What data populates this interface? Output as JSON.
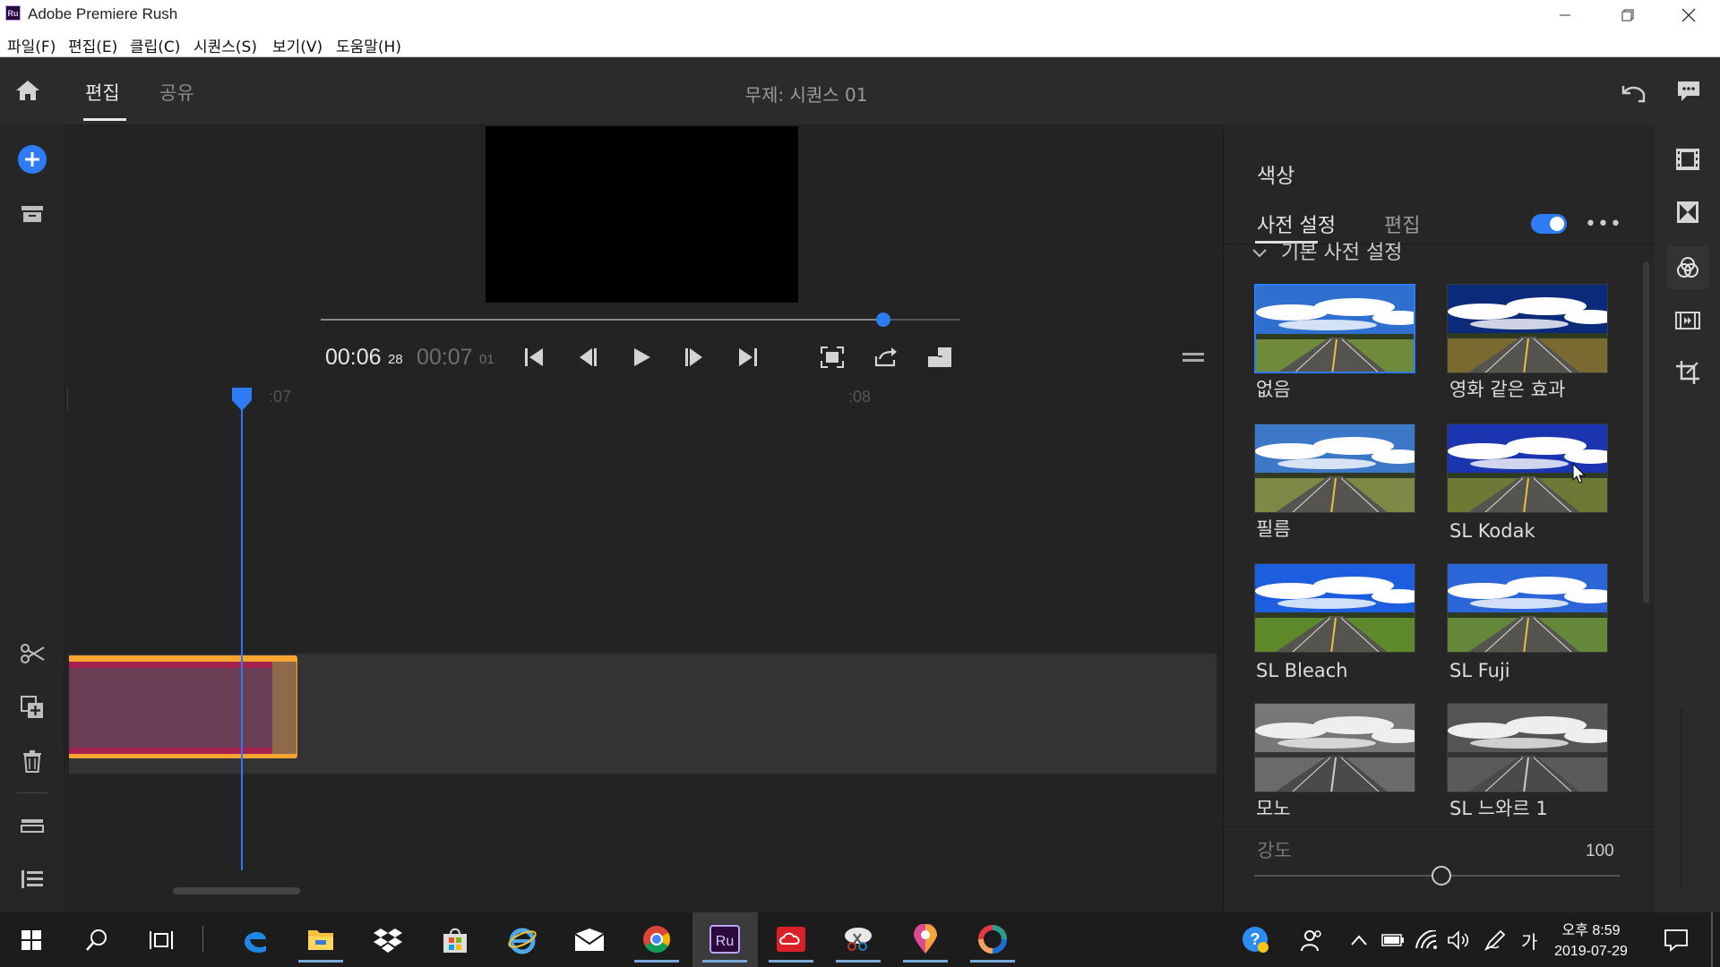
{
  "window": {
    "title": "Adobe Premiere Rush",
    "app_icon": "Ru"
  },
  "menu": [
    "파일(F)",
    "편집(E)",
    "클립(C)",
    "시퀀스(S)",
    "보기(V)",
    "도움말(H)"
  ],
  "topbar": {
    "tabs": [
      "편집",
      "공유"
    ],
    "active_tab": "편집",
    "sequence_title": "무제: 시퀀스 01"
  },
  "player": {
    "current_time": "00:06",
    "current_frames": "28",
    "duration_time": "00:07",
    "duration_frames": "01",
    "scrub_position": 0.88
  },
  "timeline": {
    "ruler_marks": [
      ":07",
      ":08"
    ]
  },
  "color_panel": {
    "title": "색상",
    "tabs": [
      "사전 설정",
      "편집"
    ],
    "active_tab": "사전 설정",
    "toggle_on": true,
    "more": "•••",
    "section_title": "기본 사전 설정",
    "presets": [
      {
        "label": "없음",
        "selected": true
      },
      {
        "label": "영화 같은 효과",
        "selected": false
      },
      {
        "label": "필름",
        "selected": false
      },
      {
        "label": "SL Kodak",
        "selected": false
      },
      {
        "label": "SL Bleach",
        "selected": false
      },
      {
        "label": "SL Fuji",
        "selected": false
      },
      {
        "label": "모노",
        "selected": false
      },
      {
        "label": "SL 느와르 1",
        "selected": false
      }
    ],
    "intensity_label": "강도",
    "intensity_value": "100"
  },
  "taskbar": {
    "clock_time": "오후 8:59",
    "clock_date": "2019-07-29",
    "ime": "가"
  },
  "colors": {
    "accent": "#2d7cf6",
    "clip_orange": "#f7a431",
    "clip_magenta": "#a4224d",
    "clip_body": "#6a3e54"
  }
}
